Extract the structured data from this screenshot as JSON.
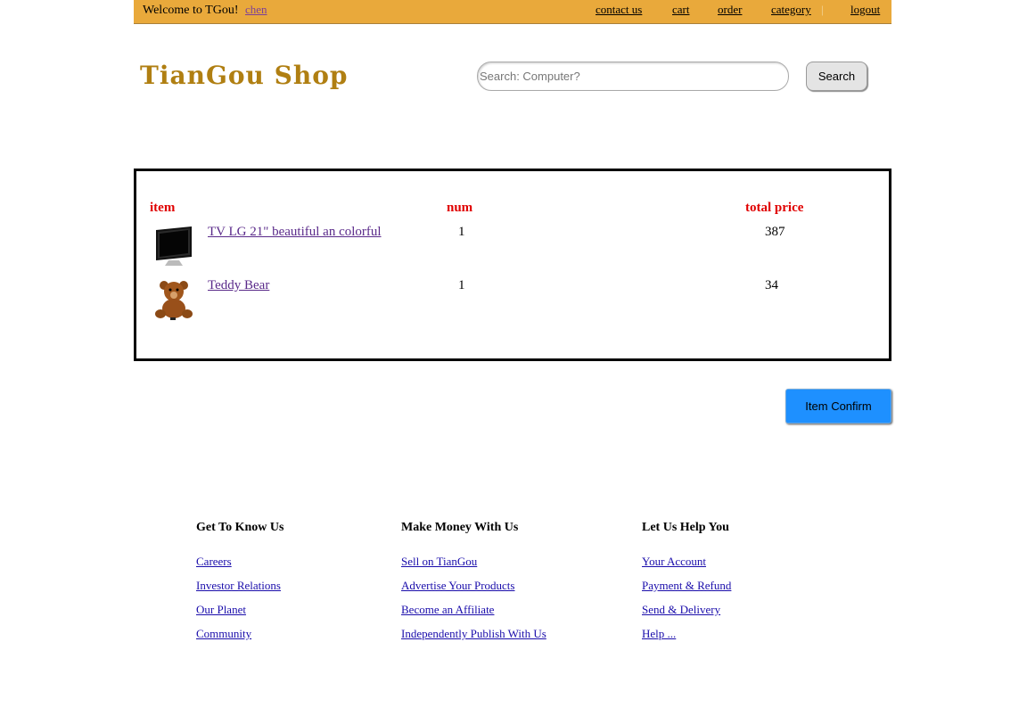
{
  "topbar": {
    "welcome": "Welcome to TGou!",
    "user": "chen",
    "nav": {
      "contact": "contact us",
      "cart": "cart",
      "order": "order",
      "category": "category",
      "separator": "|",
      "logout": "logout"
    }
  },
  "header": {
    "logo": "TianGou Shop",
    "search_placeholder": "Search: Computer?",
    "search_button": "Search"
  },
  "cart": {
    "columns": {
      "item": "item",
      "num": "num",
      "total": "total price"
    },
    "rows": [
      {
        "name": "TV LG 21\" beautiful an colorful",
        "num": "1",
        "total": "387",
        "icon": "tv-icon"
      },
      {
        "name": "Teddy Bear",
        "num": "1",
        "total": "34",
        "icon": "teddy-bear-icon"
      }
    ],
    "confirm_button": "Item Confirm"
  },
  "footer": {
    "col1": {
      "title": "Get To Know Us",
      "links": [
        "Careers",
        "Investor Relations",
        "Our Planet",
        "Community"
      ]
    },
    "col2": {
      "title": "Make Money With Us",
      "links": [
        "Sell on TianGou",
        "Advertise Your Products",
        "Become an Affiliate",
        "Independently Publish With Us"
      ]
    },
    "col3": {
      "title": "Let Us Help You",
      "links": [
        "Your Account",
        "Payment & Refund",
        "Send & Delivery",
        "Help ..."
      ]
    }
  }
}
